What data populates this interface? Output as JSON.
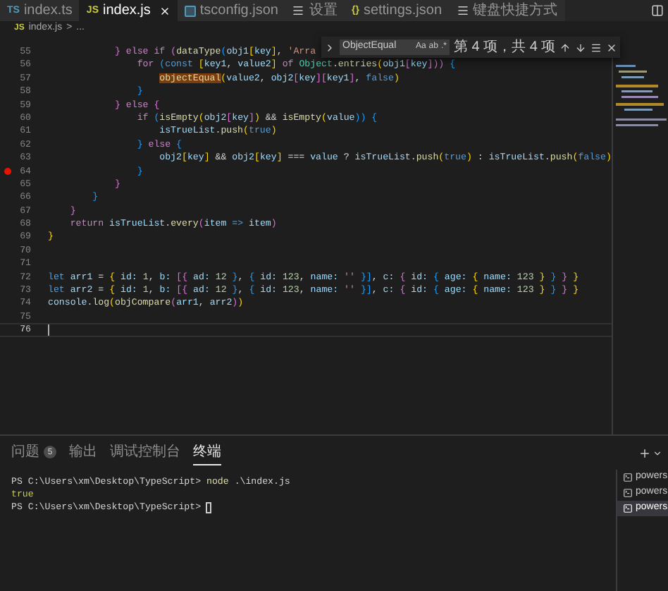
{
  "tabs": [
    {
      "label": "index.ts",
      "icon": {
        "kind": "ts",
        "text": "TS"
      },
      "selected": false
    },
    {
      "label": "index.js",
      "icon": {
        "kind": "js",
        "text": "JS"
      },
      "selected": true
    },
    {
      "label": "tsconfig.json",
      "icon": {
        "kind": "file"
      },
      "selected": false
    },
    {
      "label": "设置",
      "icon": {
        "kind": "lines"
      },
      "selected": false
    },
    {
      "label": "settings.json",
      "icon": {
        "kind": "json",
        "text": "{}"
      },
      "selected": false
    },
    {
      "label": "键盘快捷方式",
      "icon": {
        "kind": "lines"
      },
      "selected": false
    }
  ],
  "breadcrumb": {
    "icon": "JS",
    "file": "index.js",
    "separator": ">",
    "rest": "..."
  },
  "find_widget": {
    "value": "ObjectEqual",
    "options": [
      "Aa",
      "ab",
      ".*"
    ],
    "result": "第 4 项，共 4 项"
  },
  "editor": {
    "lines": [
      {
        "number": "55",
        "breakpoint": false,
        "current": false,
        "tokens": [
          {
            "text": "            }",
            "kind": "b2"
          },
          {
            "text": " else if",
            "kind": "k"
          },
          {
            "text": " (",
            "kind": "b2"
          },
          {
            "text": "dataType",
            "kind": "f"
          },
          {
            "text": "(",
            "kind": "b3"
          },
          {
            "text": "obj1",
            "kind": "v"
          },
          {
            "text": "[",
            "kind": "b1"
          },
          {
            "text": "key",
            "kind": "v"
          },
          {
            "text": "]",
            "kind": "b1"
          },
          {
            "text": ",",
            "kind": "p"
          },
          {
            "text": " 'Arra",
            "kind": "str"
          }
        ]
      },
      {
        "number": "56",
        "breakpoint": false,
        "current": false,
        "tokens": [
          {
            "text": "                for",
            "kind": "k"
          },
          {
            "text": " (",
            "kind": "b3"
          },
          {
            "text": "const",
            "kind": "s"
          },
          {
            "text": " [",
            "kind": "b1"
          },
          {
            "text": "key1",
            "kind": "v"
          },
          {
            "text": ",",
            "kind": "p"
          },
          {
            "text": " value2",
            "kind": "v"
          },
          {
            "text": "]",
            "kind": "b1"
          },
          {
            "text": " of",
            "kind": "k"
          },
          {
            "text": " Object",
            "kind": "c"
          },
          {
            "text": ".",
            "kind": "p"
          },
          {
            "text": "entries",
            "kind": "f"
          },
          {
            "text": "(",
            "kind": "b1"
          },
          {
            "text": "obj1",
            "kind": "v"
          },
          {
            "text": "[",
            "kind": "b2"
          },
          {
            "text": "key",
            "kind": "v"
          },
          {
            "text": "]))",
            "kind": "b2"
          },
          {
            "text": " {",
            "kind": "b3"
          }
        ]
      },
      {
        "number": "57",
        "breakpoint": false,
        "current": false,
        "tokens": [
          {
            "text": "                    objectEqual",
            "kind": "m"
          },
          {
            "text": "(",
            "kind": "b1"
          },
          {
            "text": "value2",
            "kind": "v"
          },
          {
            "text": ",",
            "kind": "p"
          },
          {
            "text": " obj2",
            "kind": "v"
          },
          {
            "text": "[",
            "kind": "b2"
          },
          {
            "text": "key",
            "kind": "v"
          },
          {
            "text": "][",
            "kind": "b2"
          },
          {
            "text": "key1",
            "kind": "v"
          },
          {
            "text": "]",
            "kind": "b2"
          },
          {
            "text": ",",
            "kind": "p"
          },
          {
            "text": " false",
            "kind": "s"
          },
          {
            "text": ")",
            "kind": "b1"
          }
        ]
      },
      {
        "number": "58",
        "breakpoint": false,
        "current": false,
        "tokens": [
          {
            "text": "                }",
            "kind": "b3"
          }
        ]
      },
      {
        "number": "59",
        "breakpoint": false,
        "current": false,
        "tokens": [
          {
            "text": "            }",
            "kind": "b2"
          },
          {
            "text": " else",
            "kind": "k"
          },
          {
            "text": " {",
            "kind": "b2"
          }
        ]
      },
      {
        "number": "60",
        "breakpoint": false,
        "current": false,
        "tokens": [
          {
            "text": "                if",
            "kind": "k"
          },
          {
            "text": " (",
            "kind": "b3"
          },
          {
            "text": "isEmpty",
            "kind": "f"
          },
          {
            "text": "(",
            "kind": "b1"
          },
          {
            "text": "obj2",
            "kind": "v"
          },
          {
            "text": "[",
            "kind": "b2"
          },
          {
            "text": "key",
            "kind": "v"
          },
          {
            "text": "]",
            "kind": "b2"
          },
          {
            "text": ")",
            "kind": "b1"
          },
          {
            "text": " &&",
            "kind": "p"
          },
          {
            "text": " isEmpty",
            "kind": "f"
          },
          {
            "text": "(",
            "kind": "b1"
          },
          {
            "text": "value",
            "kind": "v"
          },
          {
            "text": "))",
            "kind": "b3"
          },
          {
            "text": " {",
            "kind": "b3"
          }
        ]
      },
      {
        "number": "61",
        "breakpoint": false,
        "current": false,
        "tokens": [
          {
            "text": "                    isTrueList",
            "kind": "v"
          },
          {
            "text": ".",
            "kind": "p"
          },
          {
            "text": "push",
            "kind": "f"
          },
          {
            "text": "(",
            "kind": "b1"
          },
          {
            "text": "true",
            "kind": "s"
          },
          {
            "text": ")",
            "kind": "b1"
          }
        ]
      },
      {
        "number": "62",
        "breakpoint": false,
        "current": false,
        "tokens": [
          {
            "text": "                }",
            "kind": "b3"
          },
          {
            "text": " else",
            "kind": "k"
          },
          {
            "text": " {",
            "kind": "b3"
          }
        ]
      },
      {
        "number": "63",
        "breakpoint": false,
        "current": false,
        "tokens": [
          {
            "text": "                    obj2",
            "kind": "v"
          },
          {
            "text": "[",
            "kind": "b1"
          },
          {
            "text": "key",
            "kind": "v"
          },
          {
            "text": "]",
            "kind": "b1"
          },
          {
            "text": " &&",
            "kind": "p"
          },
          {
            "text": " obj2",
            "kind": "v"
          },
          {
            "text": "[",
            "kind": "b1"
          },
          {
            "text": "key",
            "kind": "v"
          },
          {
            "text": "]",
            "kind": "b1"
          },
          {
            "text": " ===",
            "kind": "p"
          },
          {
            "text": " value",
            "kind": "v"
          },
          {
            "text": " ?",
            "kind": "p"
          },
          {
            "text": " isTrueList",
            "kind": "v"
          },
          {
            "text": ".",
            "kind": "p"
          },
          {
            "text": "push",
            "kind": "f"
          },
          {
            "text": "(",
            "kind": "b1"
          },
          {
            "text": "true",
            "kind": "s"
          },
          {
            "text": ")",
            "kind": "b1"
          },
          {
            "text": " :",
            "kind": "p"
          },
          {
            "text": " isTrueList",
            "kind": "v"
          },
          {
            "text": ".",
            "kind": "p"
          },
          {
            "text": "push",
            "kind": "f"
          },
          {
            "text": "(",
            "kind": "b1"
          },
          {
            "text": "false",
            "kind": "s"
          },
          {
            "text": ")",
            "kind": "b1"
          }
        ]
      },
      {
        "number": "64",
        "breakpoint": true,
        "current": false,
        "tokens": [
          {
            "text": "                }",
            "kind": "b3"
          }
        ]
      },
      {
        "number": "65",
        "breakpoint": false,
        "current": false,
        "tokens": [
          {
            "text": "            }",
            "kind": "b2"
          }
        ]
      },
      {
        "number": "66",
        "breakpoint": false,
        "current": false,
        "tokens": [
          {
            "text": "        }",
            "kind": "b3"
          }
        ]
      },
      {
        "number": "67",
        "breakpoint": false,
        "current": false,
        "tokens": [
          {
            "text": "    }",
            "kind": "b2"
          }
        ]
      },
      {
        "number": "68",
        "breakpoint": false,
        "current": false,
        "tokens": [
          {
            "text": "    return",
            "kind": "k"
          },
          {
            "text": " isTrueList",
            "kind": "v"
          },
          {
            "text": ".",
            "kind": "p"
          },
          {
            "text": "every",
            "kind": "f"
          },
          {
            "text": "(",
            "kind": "b2"
          },
          {
            "text": "item",
            "kind": "v"
          },
          {
            "text": " =>",
            "kind": "s"
          },
          {
            "text": " item",
            "kind": "v"
          },
          {
            "text": ")",
            "kind": "b2"
          }
        ]
      },
      {
        "number": "69",
        "breakpoint": false,
        "current": false,
        "tokens": [
          {
            "text": "}",
            "kind": "b1"
          }
        ]
      },
      {
        "number": "70",
        "breakpoint": false,
        "current": false
      },
      {
        "number": "71",
        "breakpoint": false,
        "current": false
      },
      {
        "number": "72",
        "breakpoint": false,
        "current": false,
        "tokens": [
          {
            "text": "let",
            "kind": "s"
          },
          {
            "text": " arr1",
            "kind": "v"
          },
          {
            "text": " =",
            "kind": "p"
          },
          {
            "text": " {",
            "kind": "b1"
          },
          {
            "text": " id:",
            "kind": "v"
          },
          {
            "text": " 1",
            "kind": "n"
          },
          {
            "text": ",",
            "kind": "p"
          },
          {
            "text": " b:",
            "kind": "v"
          },
          {
            "text": " [{",
            "kind": "b2"
          },
          {
            "text": " ad:",
            "kind": "v"
          },
          {
            "text": " 12",
            "kind": "n"
          },
          {
            "text": " }",
            "kind": "b3"
          },
          {
            "text": ",",
            "kind": "p"
          },
          {
            "text": " {",
            "kind": "b3"
          },
          {
            "text": " id:",
            "kind": "v"
          },
          {
            "text": " 123",
            "kind": "n"
          },
          {
            "text": ",",
            "kind": "p"
          },
          {
            "text": " name:",
            "kind": "v"
          },
          {
            "text": " ''",
            "kind": "str"
          },
          {
            "text": " }]",
            "kind": "b3"
          },
          {
            "text": ",",
            "kind": "p"
          },
          {
            "text": " c:",
            "kind": "v"
          },
          {
            "text": " {",
            "kind": "b2"
          },
          {
            "text": " id:",
            "kind": "v"
          },
          {
            "text": " {",
            "kind": "b3"
          },
          {
            "text": " age:",
            "kind": "v"
          },
          {
            "text": " {",
            "kind": "b1"
          },
          {
            "text": " name:",
            "kind": "v"
          },
          {
            "text": " 123",
            "kind": "n"
          },
          {
            "text": " }",
            "kind": "b1"
          },
          {
            "text": " }",
            "kind": "b3"
          },
          {
            "text": " }",
            "kind": "b2"
          },
          {
            "text": " }",
            "kind": "b1"
          }
        ]
      },
      {
        "number": "73",
        "breakpoint": false,
        "current": false,
        "tokens": [
          {
            "text": "let",
            "kind": "s"
          },
          {
            "text": " arr2",
            "kind": "v"
          },
          {
            "text": " =",
            "kind": "p"
          },
          {
            "text": " {",
            "kind": "b1"
          },
          {
            "text": " id:",
            "kind": "v"
          },
          {
            "text": " 1",
            "kind": "n"
          },
          {
            "text": ",",
            "kind": "p"
          },
          {
            "text": " b:",
            "kind": "v"
          },
          {
            "text": " [{",
            "kind": "b2"
          },
          {
            "text": " ad:",
            "kind": "v"
          },
          {
            "text": " 12",
            "kind": "n"
          },
          {
            "text": " }",
            "kind": "b3"
          },
          {
            "text": ",",
            "kind": "p"
          },
          {
            "text": " {",
            "kind": "b3"
          },
          {
            "text": " id:",
            "kind": "v"
          },
          {
            "text": " 123",
            "kind": "n"
          },
          {
            "text": ",",
            "kind": "p"
          },
          {
            "text": " name:",
            "kind": "v"
          },
          {
            "text": " ''",
            "kind": "str"
          },
          {
            "text": " }]",
            "kind": "b3"
          },
          {
            "text": ",",
            "kind": "p"
          },
          {
            "text": " c:",
            "kind": "v"
          },
          {
            "text": " {",
            "kind": "b2"
          },
          {
            "text": " id:",
            "kind": "v"
          },
          {
            "text": " {",
            "kind": "b3"
          },
          {
            "text": " age:",
            "kind": "v"
          },
          {
            "text": " {",
            "kind": "b1"
          },
          {
            "text": " name:",
            "kind": "v"
          },
          {
            "text": " 123",
            "kind": "n"
          },
          {
            "text": " }",
            "kind": "b1"
          },
          {
            "text": " }",
            "kind": "b3"
          },
          {
            "text": " }",
            "kind": "b2"
          },
          {
            "text": " }",
            "kind": "b1"
          }
        ]
      },
      {
        "number": "74",
        "breakpoint": false,
        "current": false,
        "tokens": [
          {
            "text": "console",
            "kind": "v"
          },
          {
            "text": ".",
            "kind": "p"
          },
          {
            "text": "log",
            "kind": "f"
          },
          {
            "text": "(",
            "kind": "b1"
          },
          {
            "text": "objCompare",
            "kind": "f"
          },
          {
            "text": "(",
            "kind": "b2"
          },
          {
            "text": "arr1",
            "kind": "v"
          },
          {
            "text": ",",
            "kind": "p"
          },
          {
            "text": " arr2",
            "kind": "v"
          },
          {
            "text": ")",
            "kind": "b2"
          },
          {
            "text": ")",
            "kind": "b1"
          }
        ]
      },
      {
        "number": "75",
        "breakpoint": false,
        "current": false
      },
      {
        "number": "76",
        "breakpoint": false,
        "current": true
      }
    ]
  },
  "panel": {
    "tabs": [
      {
        "label": "问题",
        "count": "5",
        "selected": false
      },
      {
        "label": "输出",
        "selected": false
      },
      {
        "label": "调试控制台",
        "selected": false
      },
      {
        "label": "终端",
        "selected": true
      }
    ],
    "terminal_lines": [
      {
        "tokens": [
          {
            "text": "PS C:\\Users\\xm\\Desktop\\TypeScript>",
            "kind": "p"
          },
          {
            "text": " node",
            "kind": "cmd"
          },
          {
            "text": " .\\index.js",
            "kind": "p"
          }
        ],
        "cursor": false
      },
      {
        "tokens": [
          {
            "text": "true",
            "kind": "out"
          }
        ],
        "cursor": false
      },
      {
        "tokens": [
          {
            "text": "PS C:\\Users\\xm\\Desktop\\TypeScript>",
            "kind": "p"
          }
        ],
        "cursor": true
      }
    ],
    "terminals": [
      {
        "label": "powers",
        "selected": false
      },
      {
        "label": "powers",
        "selected": false
      },
      {
        "label": "powers",
        "selected": true
      }
    ]
  }
}
